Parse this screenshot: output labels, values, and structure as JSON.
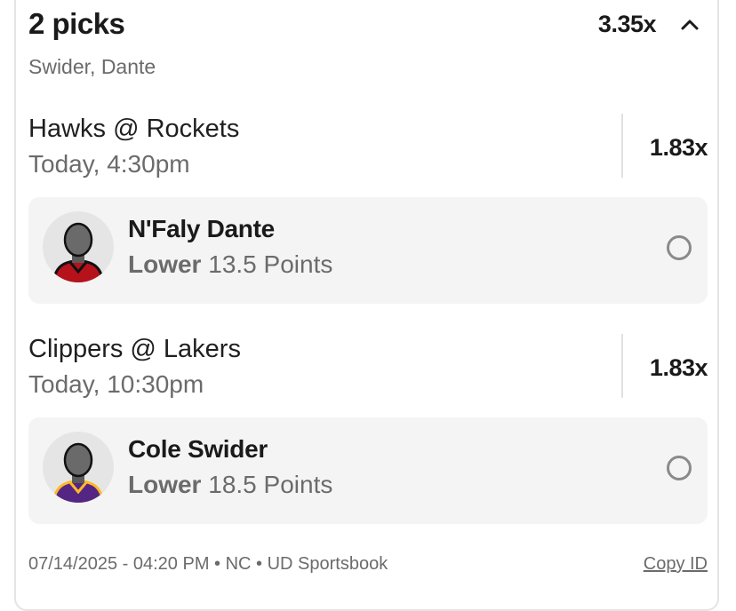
{
  "header": {
    "title": "2 picks",
    "total_multiplier": "3.35x",
    "subtitle": "Swider, Dante"
  },
  "games": [
    {
      "title": "Hawks @ Rockets",
      "time": "Today, 4:30pm",
      "multiplier": "1.83x",
      "pick": {
        "player": "N'Faly Dante",
        "direction": "Lower",
        "line": "13.5 Points",
        "jersey_color": "#b5121b",
        "jersey_trim": "#111111"
      }
    },
    {
      "title": "Clippers @ Lakers",
      "time": "Today, 10:30pm",
      "multiplier": "1.83x",
      "pick": {
        "player": "Cole Swider",
        "direction": "Lower",
        "line": "18.5 Points",
        "jersey_color": "#552583",
        "jersey_trim": "#fdb927"
      }
    }
  ],
  "footer": {
    "meta": "07/14/2025 - 04:20 PM • NC • UD Sportsbook",
    "copy_label": "Copy ID"
  },
  "icons": {
    "collapse": "chevron-up-icon",
    "player": "player-avatar-icon",
    "status": "pending-radio-icon"
  }
}
